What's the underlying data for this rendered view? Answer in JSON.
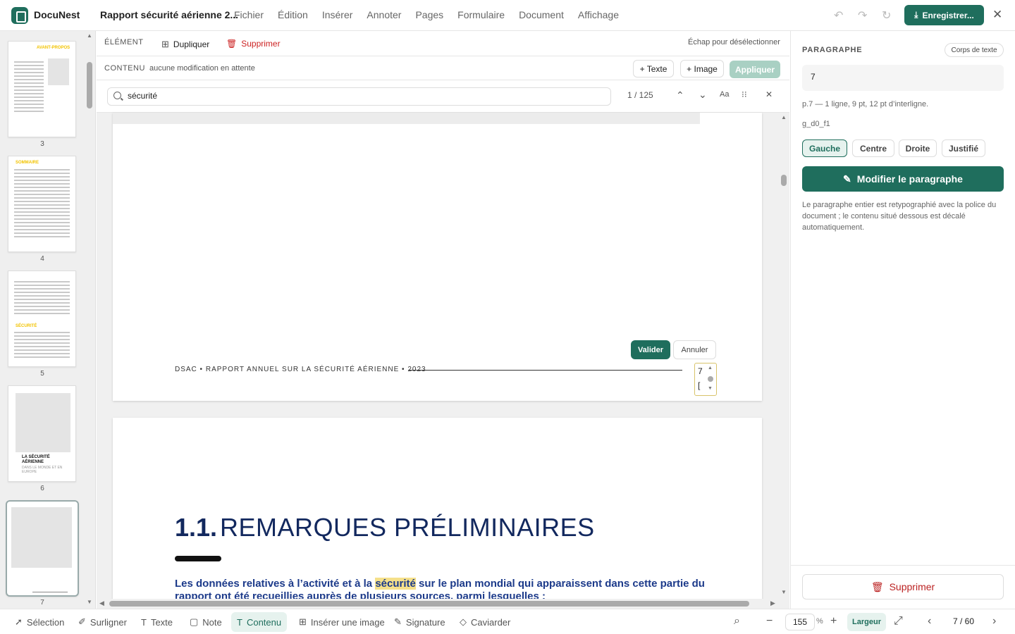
{
  "app": {
    "name": "DocuNest",
    "doc_title": "Rapport sécurité aérienne 2...",
    "save_label": "Enregistrer..."
  },
  "menu": [
    "Fichier",
    "Édition",
    "Insérer",
    "Annoter",
    "Pages",
    "Formulaire",
    "Document",
    "Affichage"
  ],
  "element_bar": {
    "label": "ÉLÉMENT",
    "duplicate": "Dupliquer",
    "delete": "Supprimer",
    "hint": "Échap pour désélectionner"
  },
  "content_bar": {
    "label": "CONTENU",
    "status": "aucune modification en attente",
    "add_text": "+ Texte",
    "add_image": "+ Image",
    "apply": "Appliquer"
  },
  "search": {
    "value": "sécurité",
    "count": "1 / 125",
    "case": "Aa"
  },
  "thumbnails": [
    {
      "num": "3",
      "tag": "AVANT-PROPOS"
    },
    {
      "num": "4",
      "tag": "SOMMAIRE"
    },
    {
      "num": "5",
      "tag": "SÉCURITÉ"
    },
    {
      "num": "6",
      "tag": "LA SÉCURITÉ AÉRIENNE",
      "sub": "DANS LE MONDE ET EN EUROPE"
    },
    {
      "num": "7",
      "tag": ""
    }
  ],
  "page": {
    "footer": "DSAC • RAPPORT ANNUEL SUR LA SÉCURITÉ AÉRIENNE • 2023",
    "validate": "Valider",
    "cancel": "Annuler",
    "spinner_value": "7",
    "spinner_bracket": "[",
    "heading_num": "1.1.",
    "heading_text": "REMARQUES PRÉLIMINAIRES",
    "para_before": "Les données relatives à l’activité et à la ",
    "para_highlight": "sécurité",
    "para_after": " sur le plan mondial qui apparaissent dans cette partie du rapport ont été recueillies auprès de plusieurs sources, parmi lesquelles :"
  },
  "panel": {
    "title": "PARAGRAPHE",
    "chip": "Corps de texte",
    "input_value": "7",
    "meta1": "p.7 — 1 ligne, 9 pt, 12 pt d’interligne.",
    "meta2": "g_d0_f1",
    "align": [
      "Gauche",
      "Centre",
      "Droite",
      "Justifié"
    ],
    "edit": "Modifier le paragraphe",
    "note": "Le paragraphe entier est retypographié avec la police du document ; le contenu situé dessous est décalé automatiquement.",
    "delete": "Supprimer"
  },
  "bottom": {
    "tools": [
      "Sélection",
      "Surligner",
      "Texte",
      "Note",
      "Contenu",
      "Insérer une image",
      "Signature",
      "Caviarder"
    ],
    "zoom": "155",
    "pct": "%",
    "fit": "Largeur",
    "pages": "7 / 60"
  },
  "colors": {
    "accent": "#1f6e5d",
    "heading": "#12285e",
    "highlight": "#f5e08a",
    "danger": "#c22222"
  }
}
